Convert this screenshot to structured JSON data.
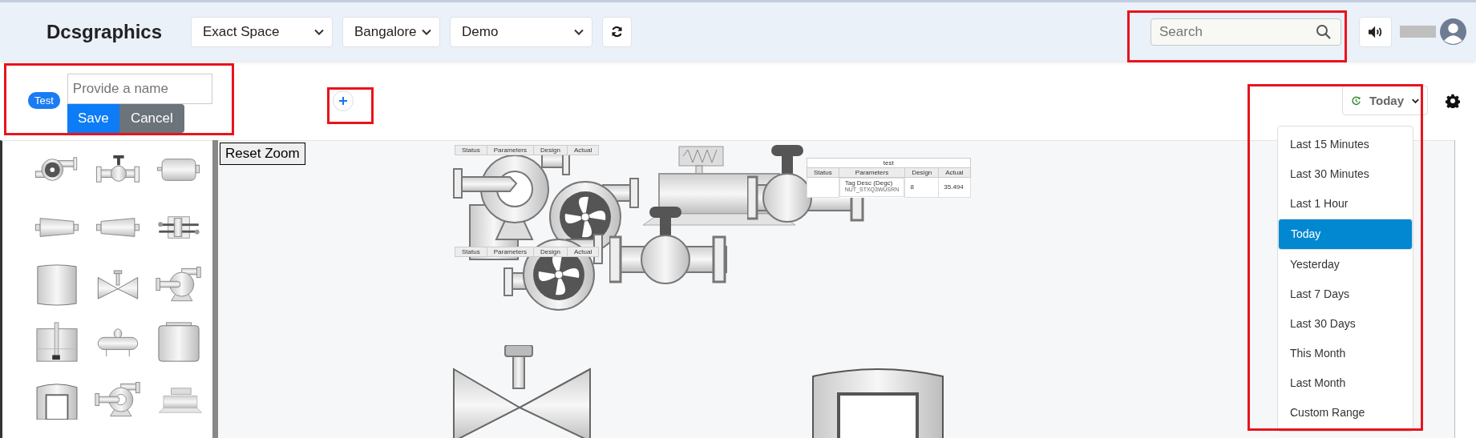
{
  "header": {
    "logo": "Dcsgraphics",
    "selects": [
      "Exact Space",
      "Bangalore",
      "Demo"
    ],
    "search": {
      "placeholder": "Search"
    }
  },
  "name_form": {
    "badge": "Test",
    "input": {
      "placeholder": "Provide a name"
    },
    "save": "Save",
    "cancel": "Cancel"
  },
  "time_filter": {
    "label": "Today",
    "options": [
      {
        "label": "Last 15 Minutes",
        "selected": false
      },
      {
        "label": "Last 30 Minutes",
        "selected": false
      },
      {
        "label": "Last 1 Hour",
        "selected": false
      },
      {
        "label": "Today",
        "selected": true
      },
      {
        "label": "Yesterday",
        "selected": false
      },
      {
        "label": "Last 7 Days",
        "selected": false
      },
      {
        "label": "Last 30 Days",
        "selected": false
      },
      {
        "label": "This Month",
        "selected": false
      },
      {
        "label": "Last Month",
        "selected": false
      },
      {
        "label": "Custom Range",
        "selected": false
      }
    ]
  },
  "canvas": {
    "reset_zoom": "Reset Zoom",
    "tables": [
      {
        "columns": [
          "Status",
          "Parameters",
          "Design",
          "Actual"
        ]
      },
      {
        "columns": [
          "Status",
          "Parameters",
          "Design",
          "Actual"
        ]
      },
      {
        "title": "test",
        "columns": [
          "Status",
          "Parameters",
          "Design",
          "Actual"
        ],
        "rows": [
          {
            "status": "",
            "parameter": "Tag Desc (Degc)",
            "tag": "NUT_STXQ3WUSRN",
            "design": "8",
            "actual": "35.494"
          }
        ]
      }
    ]
  }
}
